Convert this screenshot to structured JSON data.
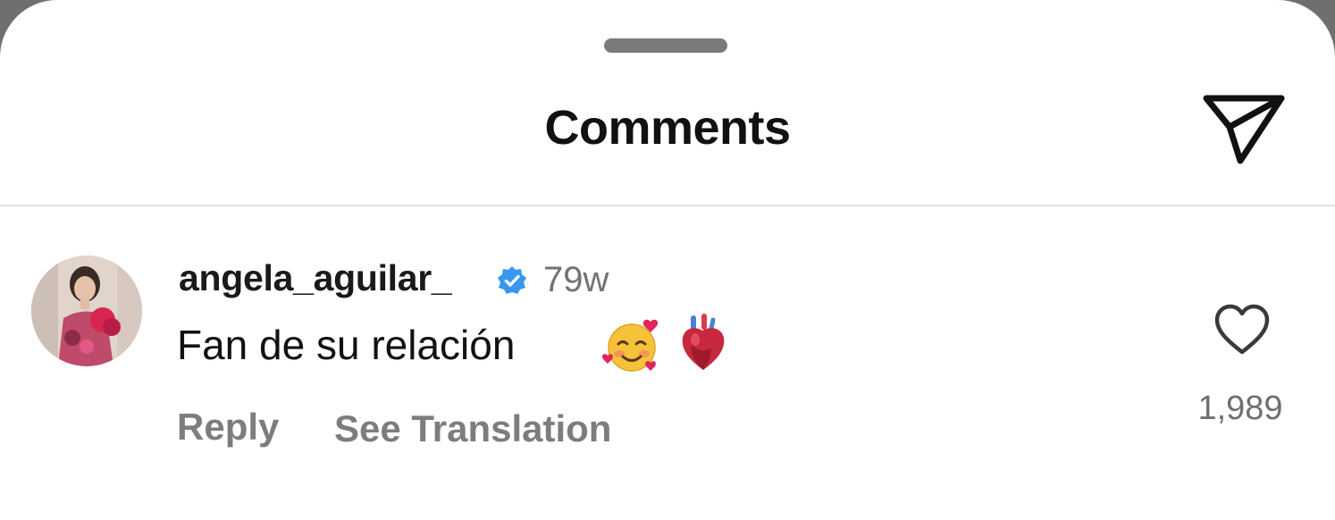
{
  "sheet": {
    "title": "Comments"
  },
  "comment": {
    "username": "angela_aguilar_",
    "verified": true,
    "time": "79w",
    "text": "Fan de su relación",
    "emojis": [
      "smiling-face-with-hearts",
      "anatomical-heart"
    ],
    "actions": {
      "reply": "Reply",
      "translate": "See Translation"
    },
    "likes": "1,989"
  },
  "colors": {
    "verified_blue": "#3897f0",
    "secondary_text": "#737373",
    "title_text": "#111111"
  },
  "icons": {
    "share": "paper-plane-icon",
    "like": "heart-outline-icon",
    "verified": "verified-badge-icon"
  }
}
